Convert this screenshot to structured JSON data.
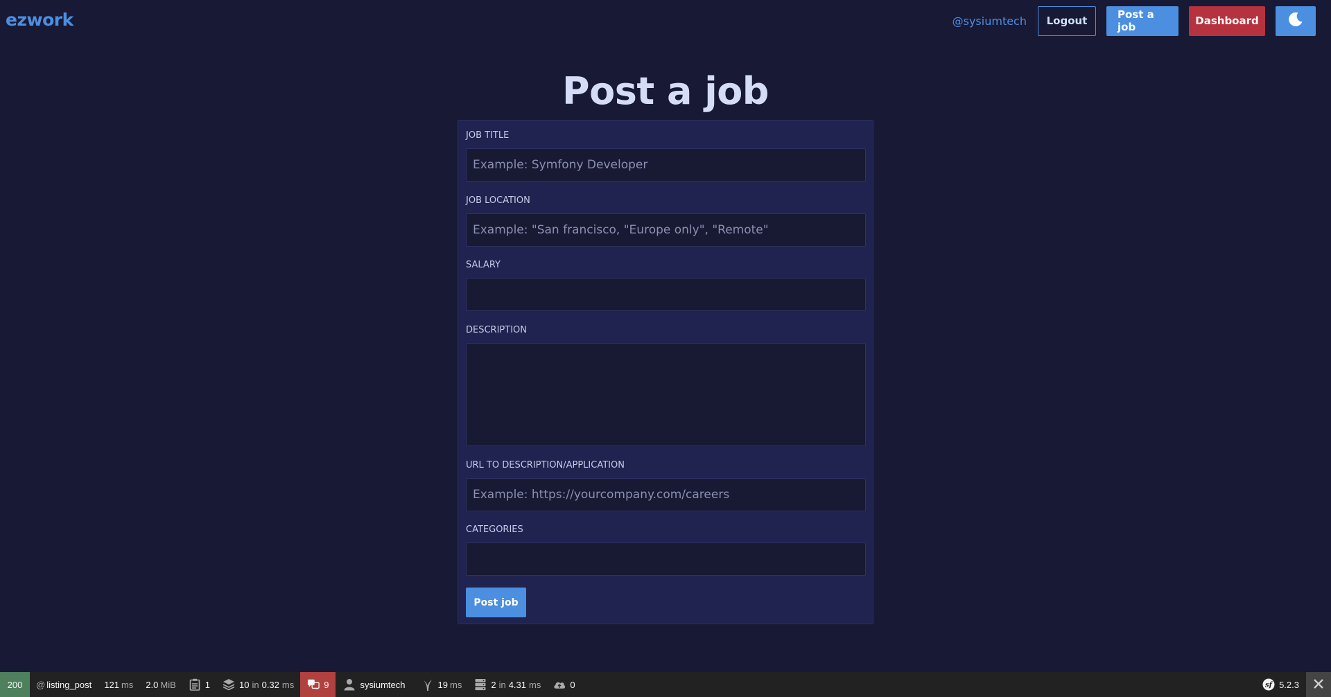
{
  "header": {
    "brand": "ezwork",
    "username": "@sysiumtech",
    "logout_label": "Logout",
    "post_job_label": "Post a job",
    "dashboard_label": "Dashboard",
    "theme_icon": "moon-icon"
  },
  "page": {
    "title": "Post a job"
  },
  "form": {
    "job_title": {
      "label": "JOB TITLE",
      "placeholder": "Example: Symfony Developer",
      "value": ""
    },
    "job_location": {
      "label": "JOB LOCATION",
      "placeholder": "Example: \"San francisco, \"Europe only\", \"Remote\"",
      "value": ""
    },
    "salary": {
      "label": "SALARY",
      "placeholder": "",
      "value": ""
    },
    "description": {
      "label": "DESCRIPTION",
      "placeholder": "",
      "value": ""
    },
    "url": {
      "label": "URL TO DESCRIPTION/APPLICATION",
      "placeholder": "Example: https://yourcompany.com/careers",
      "value": ""
    },
    "categories": {
      "label": "CATEGORIES",
      "placeholder": "",
      "value": ""
    },
    "submit_label": "Post job"
  },
  "debug_toolbar": {
    "status_code": "200",
    "route_prefix": "@",
    "route": "listing_post",
    "time_value": "121",
    "time_unit": "ms",
    "memory_value": "2.0",
    "memory_unit": "MiB",
    "logs_count": "1",
    "forms_count": "10",
    "forms_in": "in",
    "forms_time": "0.32",
    "forms_unit": "ms",
    "translation_count": "9",
    "user": "sysiumtech",
    "twig_time": "19",
    "twig_unit": "ms",
    "db_count": "2",
    "db_in": "in",
    "db_time": "4.31",
    "db_unit": "ms",
    "uploads_count": "0",
    "symfony_version": "5.2.3",
    "colors": {
      "status_ok": "#4f805d",
      "translation_alert": "#b0413e"
    }
  },
  "colors": {
    "background": "#181935",
    "card": "#202350",
    "accent": "#4c8fe0",
    "danger": "#b7323f"
  }
}
